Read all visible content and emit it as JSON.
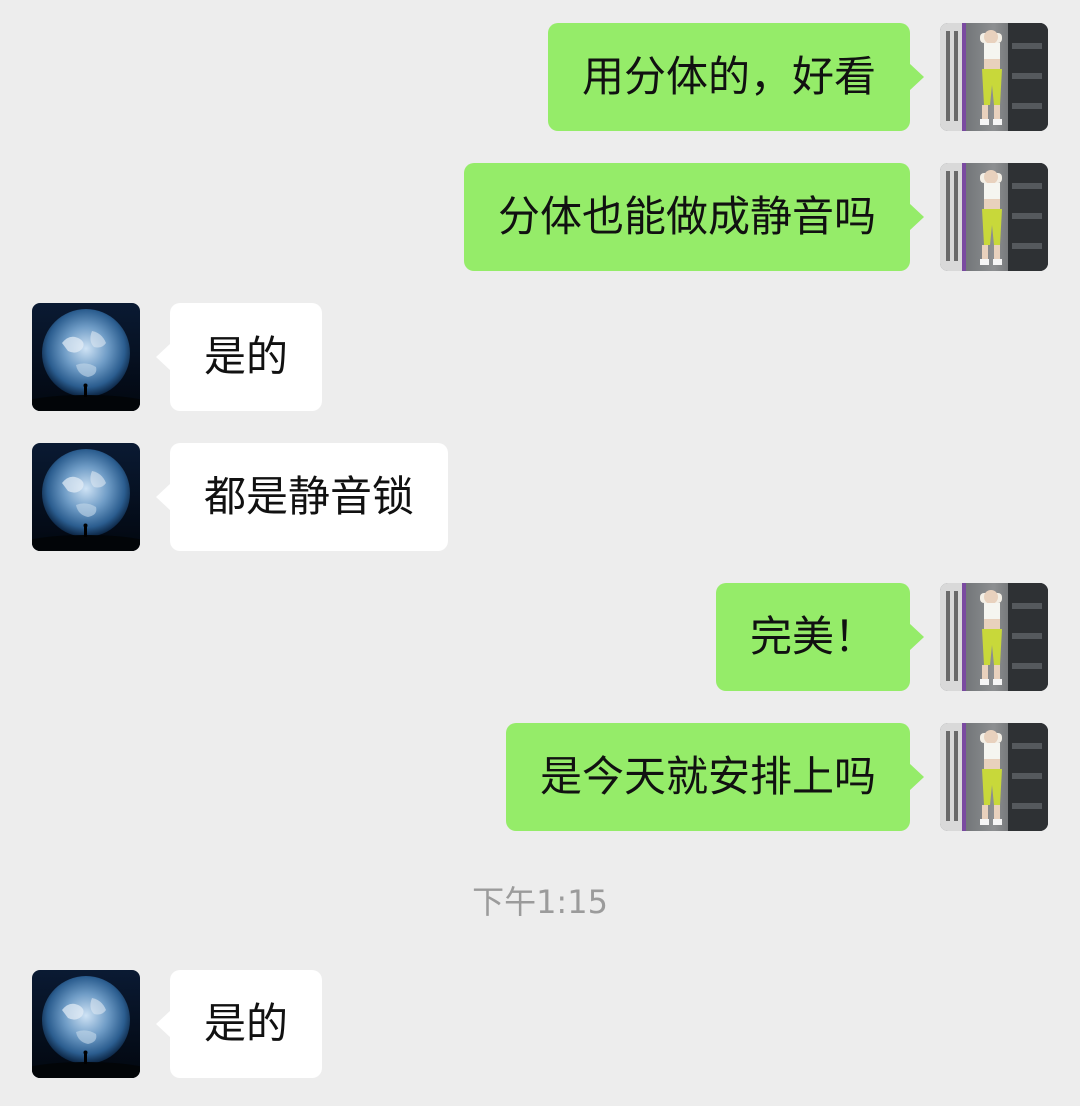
{
  "messages": [
    {
      "sender": "me",
      "text": "用分体的，好看"
    },
    {
      "sender": "me",
      "text": "分体也能做成静音吗"
    },
    {
      "sender": "other",
      "text": "是的"
    },
    {
      "sender": "other",
      "text": "都是静音锁"
    },
    {
      "sender": "me",
      "text": "完美！"
    },
    {
      "sender": "me",
      "text": "是今天就安排上吗"
    },
    {
      "sender": "other",
      "text": "是的"
    }
  ],
  "timestamp": "下午1:15",
  "colors": {
    "background": "#EDEDED",
    "my_bubble": "#95EC69",
    "their_bubble": "#FFFFFF",
    "timestamp_text": "#9B9B9B"
  },
  "icons": {
    "my_avatar": "gym-selfie-avatar",
    "their_avatar": "earth-avatar"
  }
}
